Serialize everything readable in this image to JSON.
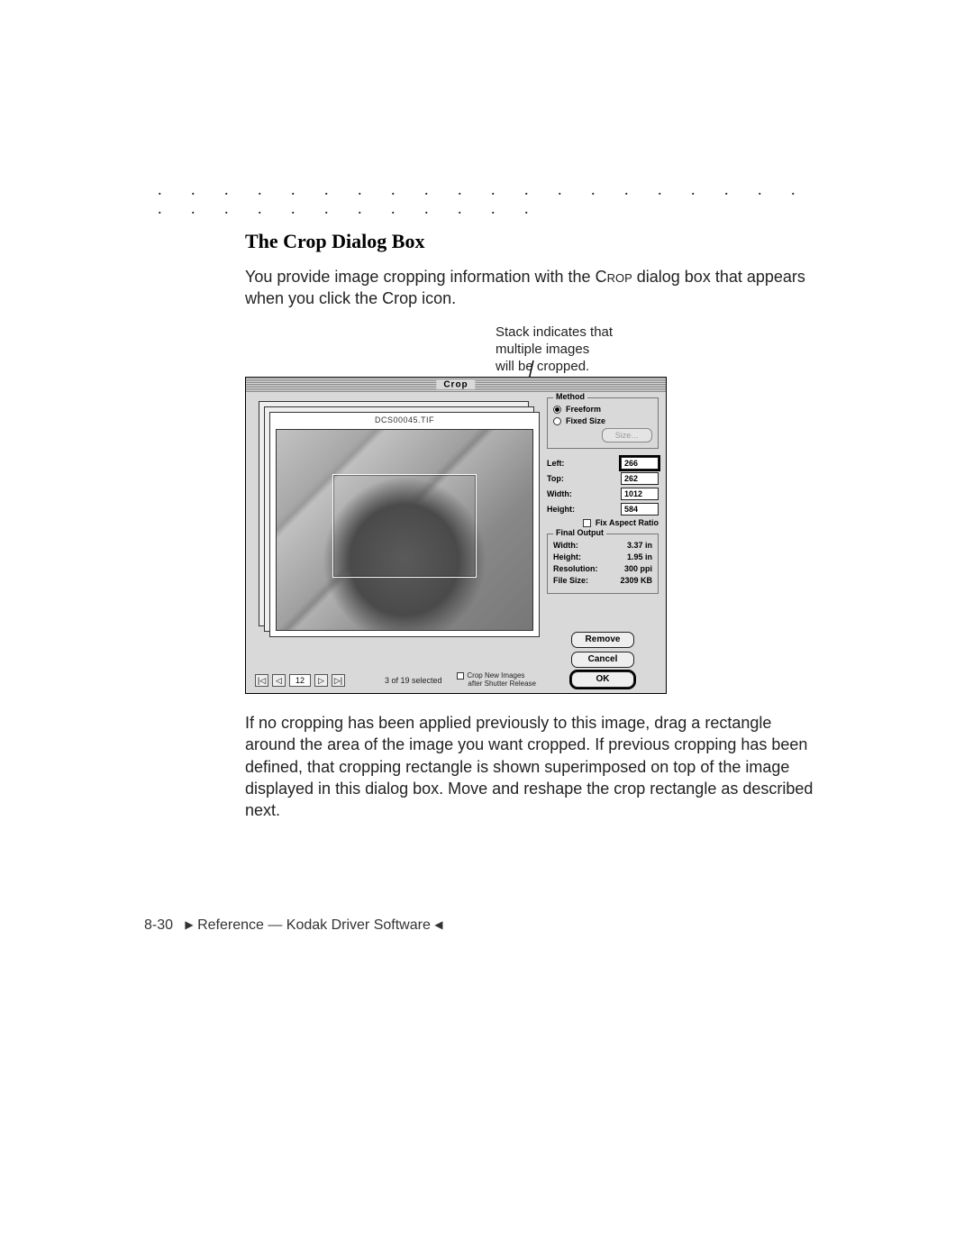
{
  "dots": ". . . . . . . . . . . . . . . . . . . . . . . . . . . . . . . .",
  "heading": "The Crop Dialog Box",
  "para1_a": "You provide image cropping information with the ",
  "para1_sc": "Crop",
  "para1_b": " dialog box that appears when you click the Crop icon.",
  "annotation": {
    "l1": "Stack indicates that",
    "l2": "multiple images",
    "l3": "will be cropped."
  },
  "dialog": {
    "title": "Crop",
    "filename": "DCS00045.TIF",
    "nav": {
      "first": "|◁",
      "prev": "◁",
      "num": "12",
      "next": "▷",
      "last": "▷|"
    },
    "selected_text": "3 of 19 selected",
    "shutter": {
      "l1": "Crop New Images",
      "l2": "after Shutter Release"
    },
    "method": {
      "label": "Method",
      "freeform": "Freeform",
      "fixed": "Fixed Size",
      "size_btn": "Size…"
    },
    "coords": {
      "left_label": "Left:",
      "left": "266",
      "top_label": "Top:",
      "top": "262",
      "width_label": "Width:",
      "width": "1012",
      "height_label": "Height:",
      "height": "584",
      "fix_ar": "Fix Aspect Ratio"
    },
    "final": {
      "label": "Final Output",
      "width_label": "Width:",
      "width": "3.37 in",
      "height_label": "Height:",
      "height": "1.95 in",
      "res_label": "Resolution:",
      "res": "300 ppi",
      "fs_label": "File Size:",
      "fs": "2309 KB"
    },
    "buttons": {
      "remove": "Remove",
      "cancel": "Cancel",
      "ok": "OK"
    }
  },
  "para2": "If no cropping has been applied previously to this image, drag a rectangle around the area of the image you want cropped. If previous cropping has been defined, that cropping rectangle is shown superimposed on top of the image displayed in this dialog box. Move and reshape the crop rectangle as described next.",
  "footer": {
    "page": "8-30",
    "tri_r": "▶",
    "text": "Reference — Kodak Driver Software",
    "tri_l": "◀"
  }
}
